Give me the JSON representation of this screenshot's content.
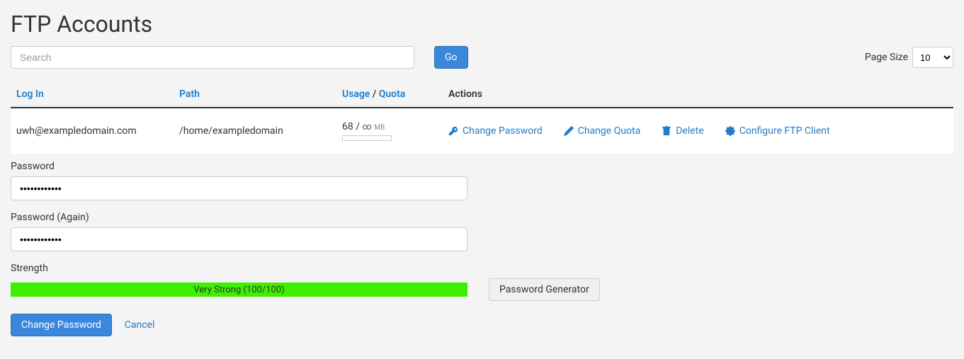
{
  "page_title": "FTP Accounts",
  "search": {
    "placeholder": "Search",
    "go_label": "Go"
  },
  "page_size": {
    "label": "Page Size",
    "value": "10",
    "options": [
      "10"
    ]
  },
  "table": {
    "headers": {
      "login": "Log In",
      "path": "Path",
      "usage": "Usage",
      "quota": "Quota",
      "actions": "Actions"
    },
    "rows": [
      {
        "login": "uwh@exampledomain.com",
        "path": "/home/exampledomain",
        "usage_value": "68",
        "usage_sep": " / ",
        "quota_value": "∞",
        "unit": "MB",
        "actions": {
          "change_password": "Change Password",
          "change_quota": "Change Quota",
          "delete": "Delete",
          "configure": "Configure FTP Client"
        }
      }
    ]
  },
  "password_form": {
    "password_label": "Password",
    "password_value": "••••••••••••",
    "password_again_label": "Password (Again)",
    "password_again_value": "••••••••••••",
    "strength_label": "Strength",
    "strength_text": "Very Strong (100/100)",
    "generator_label": "Password Generator",
    "submit_label": "Change Password",
    "cancel_label": "Cancel"
  }
}
